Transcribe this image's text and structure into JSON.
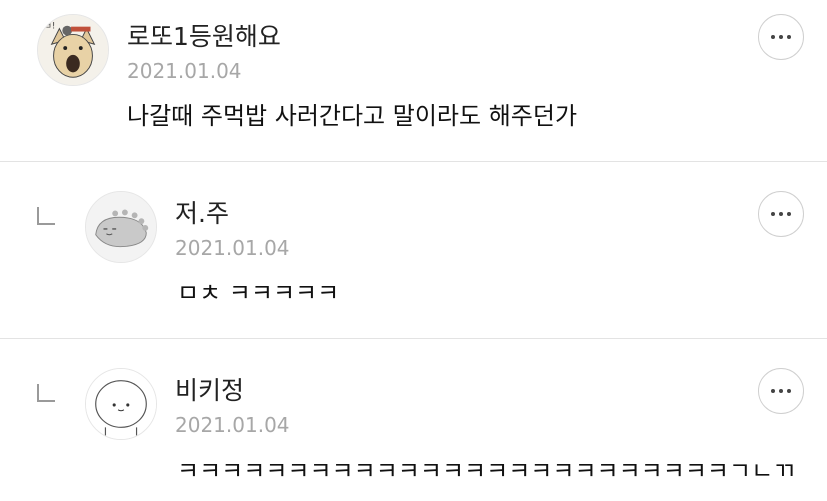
{
  "comments": [
    {
      "author": "로또1등원해요",
      "date": "2021.01.04",
      "text": "나갈때 주먹밥 사러간다고 말이라도 해주던가",
      "avatar_icon": "crying-dog-sticker-icon",
      "is_reply": false
    },
    {
      "author": "저.주",
      "date": "2021.01.04",
      "text": "ㅁㅊ ㅋㅋㅋㅋㅋ",
      "avatar_icon": "gray-dinosaur-icon",
      "is_reply": true
    },
    {
      "author": "비키정",
      "date": "2021.01.04",
      "text": "ㅋㅋㅋㅋㅋㅋㅋㅋㅋㅋㅋㅋㅋㅋㅋㅋㅋㅋㅋㅋㅋㅋㅋㅋㅋㄱㄴㄲ",
      "avatar_icon": "round-cat-face-icon",
      "is_reply": true
    }
  ],
  "more_button_label": "more-options",
  "colors": {
    "text": "#222222",
    "date": "#a7a7a7",
    "divider": "#e3e3e3"
  }
}
